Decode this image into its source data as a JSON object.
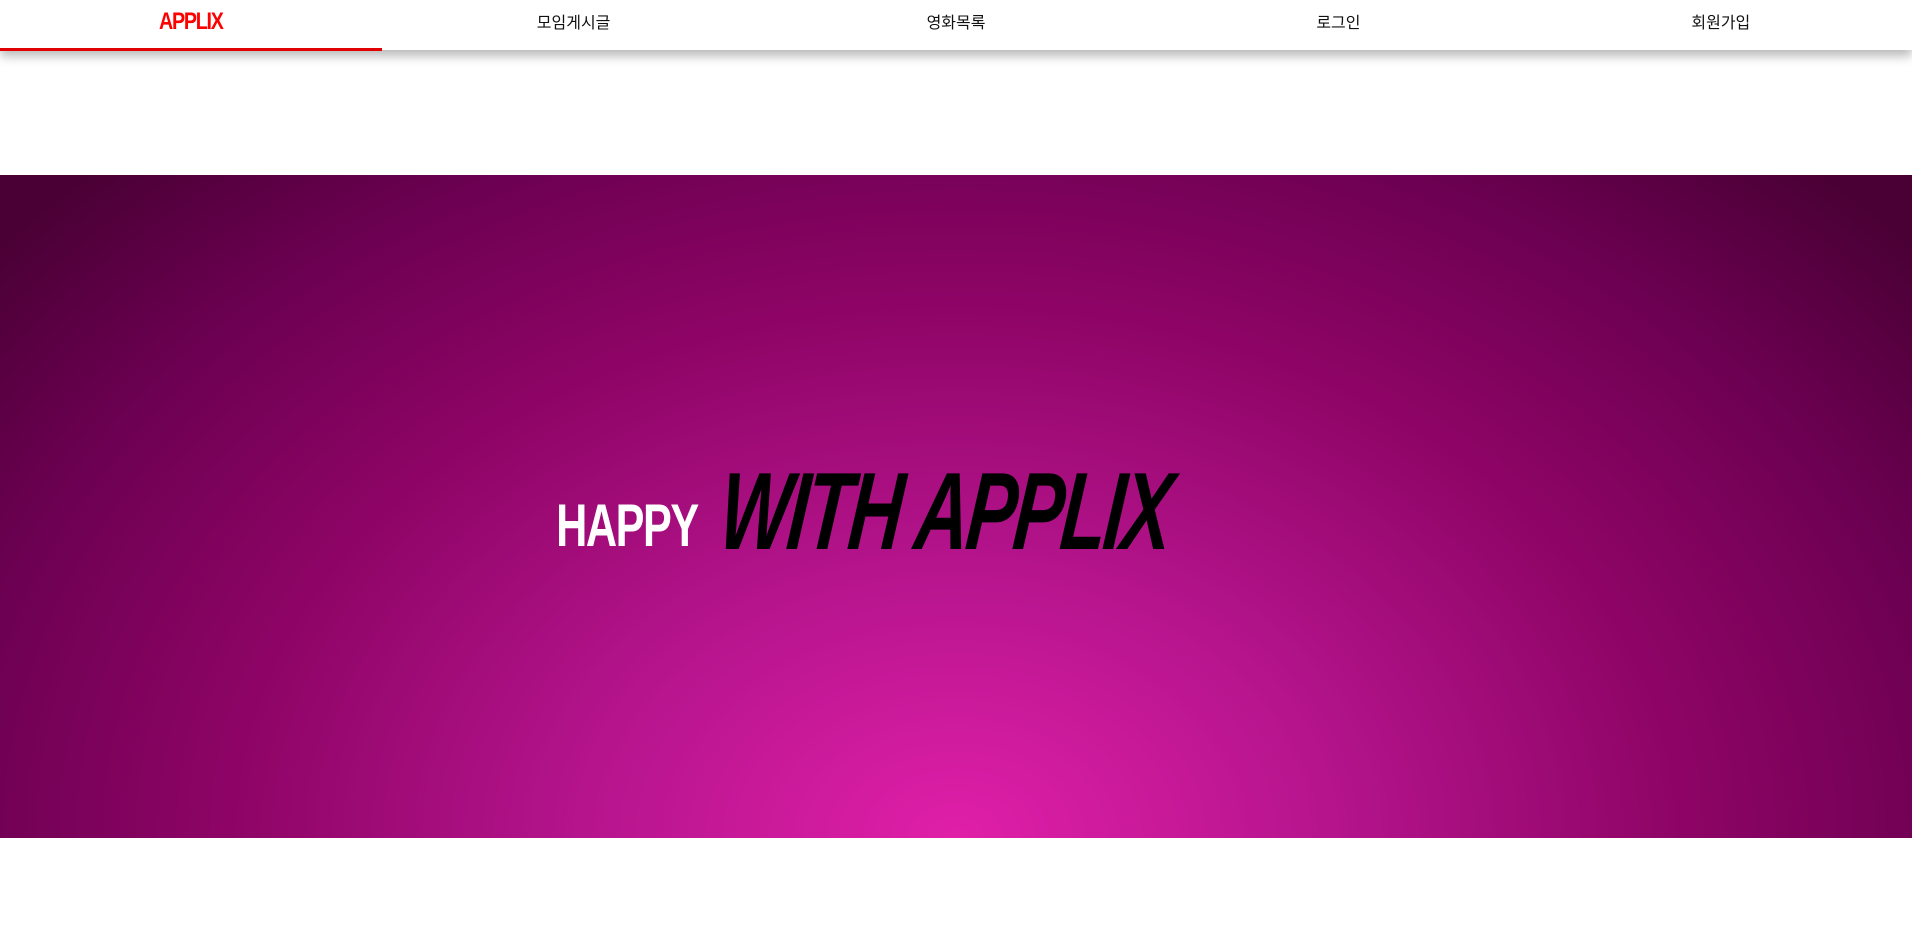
{
  "nav": {
    "logo": "APPLIX",
    "items": [
      "모임게시글",
      "영화목록",
      "로그인",
      "회원가입"
    ]
  },
  "hero": {
    "word1": "HAPPY",
    "word2": "WITH APPLIX"
  },
  "colors": {
    "brand": "#ff0000",
    "active_underline": "#e00000",
    "hero_center": "#e01fa8",
    "hero_edge": "#4a0035",
    "hero_word1": "#ffffff",
    "hero_word2": "#000000"
  }
}
